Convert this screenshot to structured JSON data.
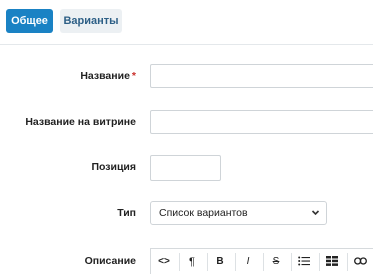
{
  "tabs": {
    "general": "Общее",
    "variants": "Варианты"
  },
  "form": {
    "name_label": "Название",
    "required_mark": "*",
    "storefront_name_label": "Название на витрине",
    "position_label": "Позиция",
    "type_label": "Тип",
    "type_value": "Список вариантов",
    "description_label": "Описание"
  },
  "editor": {
    "code": "<>",
    "paragraph": "¶",
    "bold": "B",
    "italic": "I",
    "strike": "S"
  },
  "colors": {
    "accent": "#1a82c4",
    "tab_inactive_bg": "#ecf0f3",
    "required": "#c9302c"
  }
}
